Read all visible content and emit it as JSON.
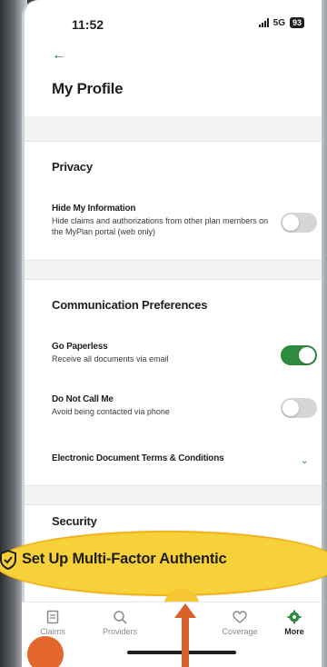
{
  "status_bar": {
    "time": "11:52",
    "network": "5G",
    "battery": "93"
  },
  "header": {
    "title": "My Profile"
  },
  "privacy": {
    "section_title": "Privacy",
    "hide_info": {
      "title": "Hide My Information",
      "description": "Hide claims and authorizations from other plan members on the MyPlan portal (web only)",
      "enabled": false
    }
  },
  "communication": {
    "section_title": "Communication Preferences",
    "go_paperless": {
      "title": "Go Paperless",
      "description": "Receive all documents via email",
      "enabled": true
    },
    "do_not_call": {
      "title": "Do Not Call Me",
      "description": "Avoid being contacted via phone",
      "enabled": false
    },
    "terms": {
      "title": "Electronic Document Terms & Conditions"
    }
  },
  "security": {
    "section_title": "Security"
  },
  "mfa_banner": {
    "label": "Set Up Multi-Factor Authentic"
  },
  "bottom_nav": {
    "items": [
      {
        "label": "Claims"
      },
      {
        "label": "Providers"
      },
      {
        "label": "Coverage"
      },
      {
        "label": "More"
      }
    ]
  },
  "colors": {
    "accent_green": "#2e8b3d",
    "highlight_yellow": "#f6d13a",
    "annotation_orange": "#d8602b"
  }
}
